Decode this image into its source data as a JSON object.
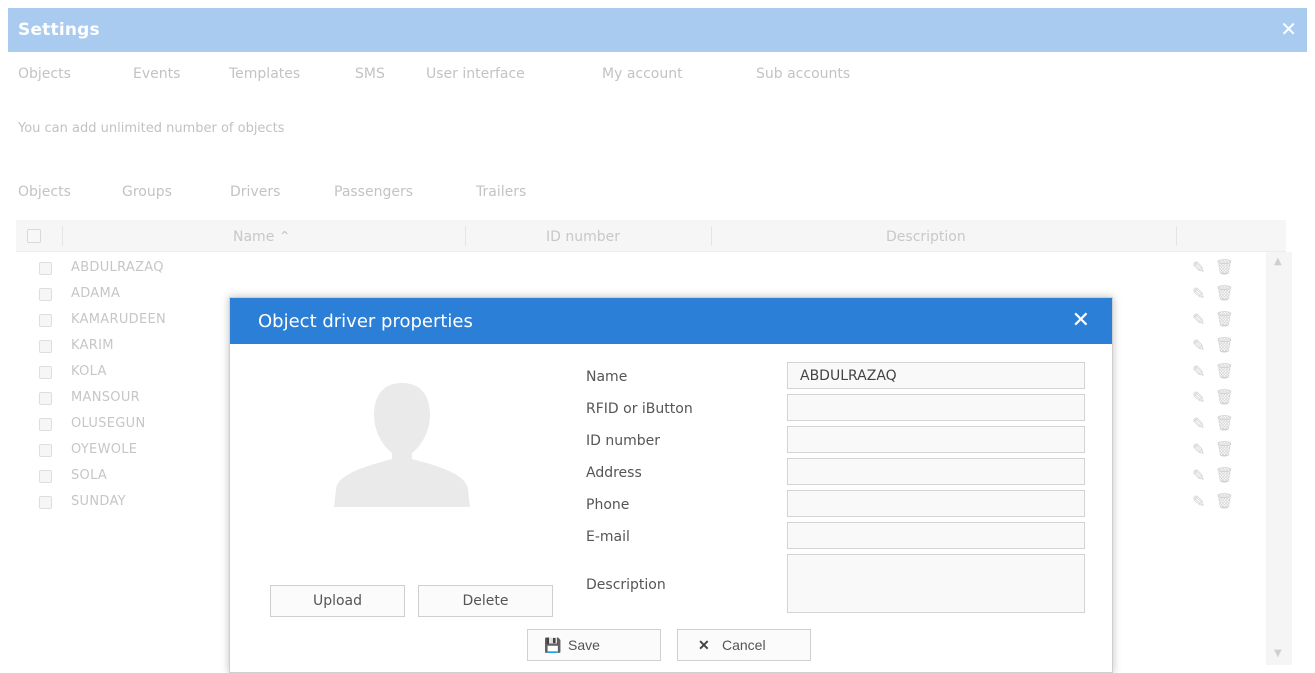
{
  "settings": {
    "title": "Settings",
    "close_glyph": "✕",
    "tabs": [
      {
        "label": "Objects"
      },
      {
        "label": "Events"
      },
      {
        "label": "Templates"
      },
      {
        "label": "SMS"
      },
      {
        "label": "User interface"
      },
      {
        "label": "My account"
      },
      {
        "label": "Sub accounts"
      }
    ],
    "info_text": "You can add unlimited number of objects",
    "subtabs": [
      {
        "label": "Objects"
      },
      {
        "label": "Groups"
      },
      {
        "label": "Drivers"
      },
      {
        "label": "Passengers"
      },
      {
        "label": "Trailers"
      }
    ]
  },
  "drivers_grid": {
    "columns": {
      "name": "Name",
      "sort_indicator": "⌃",
      "id_number": "ID number",
      "description": "Description"
    },
    "rows": [
      {
        "name": "ABDULRAZAQ"
      },
      {
        "name": "ADAMA"
      },
      {
        "name": "KAMARUDEEN"
      },
      {
        "name": "KARIM"
      },
      {
        "name": "KOLA"
      },
      {
        "name": "MANSOUR"
      },
      {
        "name": "OLUSEGUN"
      },
      {
        "name": "OYEWOLE"
      },
      {
        "name": "SOLA"
      },
      {
        "name": "SUNDAY"
      }
    ],
    "edit_icon": "pencil-icon",
    "delete_icon": "trash-icon"
  },
  "dialog": {
    "title": "Object driver properties",
    "close_glyph": "✕",
    "upload_label": "Upload",
    "delete_label": "Delete",
    "fields": {
      "name_label": "Name",
      "name_value": "ABDULRAZAQ",
      "rfid_label": "RFID or iButton",
      "id_number_label": "ID number",
      "address_label": "Address",
      "phone_label": "Phone",
      "email_label": "E-mail",
      "description_label": "Description"
    },
    "save_label": "Save",
    "cancel_label": "Cancel"
  },
  "colors": {
    "settings_titlebar": "#a9cbef",
    "dialog_titlebar": "#2b7fd6"
  }
}
